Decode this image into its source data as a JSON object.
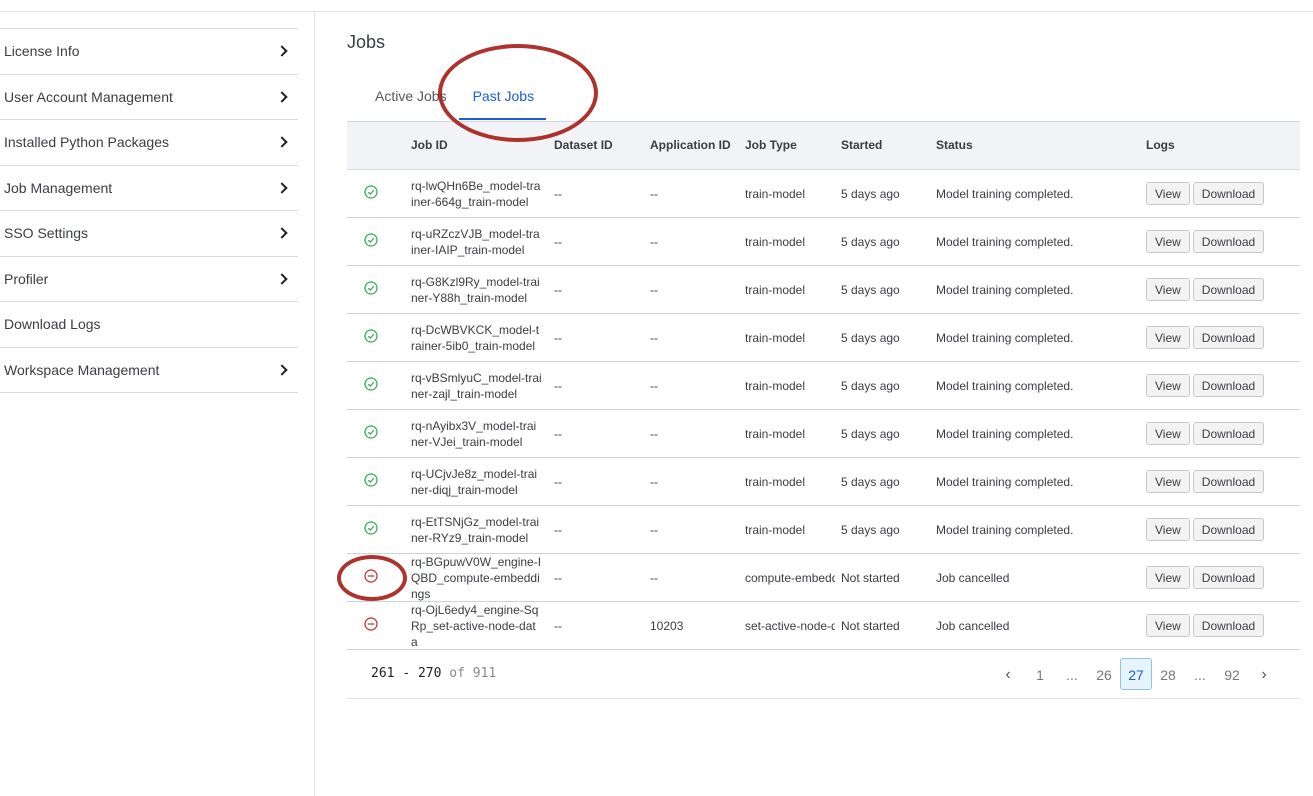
{
  "sidebar": {
    "items": [
      {
        "label": "License Info",
        "has_chevron": true
      },
      {
        "label": "User Account Management",
        "has_chevron": true
      },
      {
        "label": "Installed Python Packages",
        "has_chevron": true
      },
      {
        "label": "Job Management",
        "has_chevron": true
      },
      {
        "label": "SSO Settings",
        "has_chevron": true
      },
      {
        "label": "Profiler",
        "has_chevron": true
      },
      {
        "label": "Download Logs",
        "has_chevron": false
      },
      {
        "label": "Workspace Management",
        "has_chevron": true
      }
    ]
  },
  "main": {
    "title": "Jobs",
    "tabs": [
      {
        "label": "Active Jobs",
        "active": false
      },
      {
        "label": "Past Jobs",
        "active": true
      }
    ]
  },
  "table": {
    "columns": [
      "",
      "Job ID",
      "Dataset ID",
      "Application ID",
      "Job Type",
      "Started",
      "Status",
      "Logs"
    ],
    "view_label": "View",
    "download_label": "Download",
    "rows": [
      {
        "status": "success",
        "job_id": "rq-lwQHn6Be_model-trainer-664g_train-model",
        "dataset_id": "--",
        "application_id": "--",
        "job_type": "train-model",
        "started": "5 days ago",
        "status_text": "Model training completed."
      },
      {
        "status": "success",
        "job_id": "rq-uRZczVJB_model-trainer-IAIP_train-model",
        "dataset_id": "--",
        "application_id": "--",
        "job_type": "train-model",
        "started": "5 days ago",
        "status_text": "Model training completed."
      },
      {
        "status": "success",
        "job_id": "rq-G8Kzl9Ry_model-trainer-Y88h_train-model",
        "dataset_id": "--",
        "application_id": "--",
        "job_type": "train-model",
        "started": "5 days ago",
        "status_text": "Model training completed."
      },
      {
        "status": "success",
        "job_id": "rq-DcWBVKCK_model-trainer-5ib0_train-model",
        "dataset_id": "--",
        "application_id": "--",
        "job_type": "train-model",
        "started": "5 days ago",
        "status_text": "Model training completed."
      },
      {
        "status": "success",
        "job_id": "rq-vBSmlyuC_model-trainer-zajl_train-model",
        "dataset_id": "--",
        "application_id": "--",
        "job_type": "train-model",
        "started": "5 days ago",
        "status_text": "Model training completed."
      },
      {
        "status": "success",
        "job_id": "rq-nAyibx3V_model-trainer-VJei_train-model",
        "dataset_id": "--",
        "application_id": "--",
        "job_type": "train-model",
        "started": "5 days ago",
        "status_text": "Model training completed."
      },
      {
        "status": "success",
        "job_id": "rq-UCjvJe8z_model-trainer-diqj_train-model",
        "dataset_id": "--",
        "application_id": "--",
        "job_type": "train-model",
        "started": "5 days ago",
        "status_text": "Model training completed."
      },
      {
        "status": "success",
        "job_id": "rq-EtTSNjGz_model-trainer-RYz9_train-model",
        "dataset_id": "--",
        "application_id": "--",
        "job_type": "train-model",
        "started": "5 days ago",
        "status_text": "Model training completed."
      },
      {
        "status": "cancelled",
        "job_id": "rq-BGpuwV0W_engine-IQBD_compute-embeddings",
        "dataset_id": "--",
        "application_id": "--",
        "job_type": "compute-embeddings",
        "started": "Not started",
        "status_text": "Job cancelled"
      },
      {
        "status": "cancelled",
        "job_id": "rq-OjL6edy4_engine-SqRp_set-active-node-data",
        "dataset_id": "--",
        "application_id": "10203",
        "job_type": "set-active-node-data",
        "started": "Not started",
        "status_text": "Job cancelled"
      }
    ]
  },
  "pagination": {
    "range_start": "261",
    "range_sep": "-",
    "range_end": "270",
    "of_label": "of",
    "total": "911",
    "pages": [
      "1",
      "...",
      "26",
      "27",
      "28",
      "...",
      "92"
    ],
    "current_page": "27"
  },
  "colors": {
    "accent": "#1f5fd1",
    "success": "#2fa84f",
    "cancelled": "#c0282d",
    "annotation": "#a31d17"
  }
}
